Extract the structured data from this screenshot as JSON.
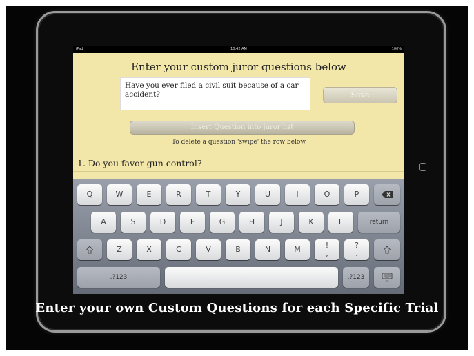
{
  "statusbar": {
    "carrier": "iPad",
    "time": "10:42 AM",
    "battery": "100%"
  },
  "screen": {
    "title": "Enter your custom juror questions below",
    "question_text": "Have you ever filed a civil suit because of a car accident?",
    "save_label": "Save",
    "insert_label": "Insert Question into juror list",
    "hint": "To delete a question 'swipe' the row below",
    "questions": [
      "1. Do you favor gun control?"
    ]
  },
  "keyboard": {
    "row1": [
      "Q",
      "W",
      "E",
      "R",
      "T",
      "Y",
      "U",
      "I",
      "O",
      "P"
    ],
    "row2": [
      "A",
      "S",
      "D",
      "F",
      "G",
      "H",
      "J",
      "K",
      "L"
    ],
    "row3": [
      "Z",
      "X",
      "C",
      "V",
      "B",
      "N",
      "M"
    ],
    "excl": [
      "!",
      ","
    ],
    "quest": [
      "?",
      "."
    ],
    "return_label": "return",
    "numbers_label": ".?123",
    "backspace_icon": "backspace-icon",
    "shift_icon": "shift-icon",
    "hide_keyboard_icon": "hide-keyboard-icon"
  },
  "caption": "Enter your own Custom Questions for each Specific Trial"
}
